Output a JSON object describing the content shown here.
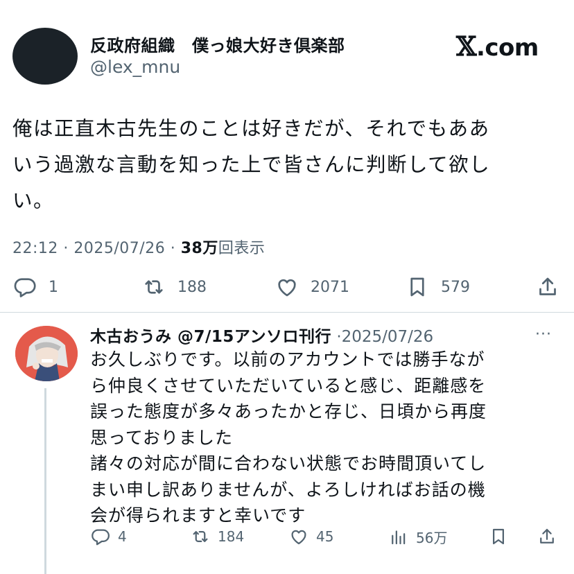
{
  "post": {
    "author_name": "反政府組織　僕っ娘大好き倶楽部",
    "author_handle": "@lex_mnu",
    "site_mark": "𝕏",
    "site_suffix": ".com",
    "text_lines": [
      "俺は正直木古先生のことは好きだが、それでもああ",
      "いう過激な言動を知った上で皆さんに判断して欲し",
      "い。"
    ],
    "time": "22:12",
    "separator": "·",
    "date": "2025/07/26",
    "views_count": "38万",
    "views_label": "回表示",
    "replies": "1",
    "reposts": "188",
    "likes": "2071",
    "bookmarks": "579"
  },
  "reply": {
    "author_name": "木古おうみ @7/15アンソロ刊行",
    "separator": "·",
    "date": "2025/07/26",
    "more": "···",
    "text_lines": [
      "お久しぶりです。以前のアカウントでは勝手なが",
      "ら仲良くさせていただいていると感じ、距離感を",
      "誤った態度が多々あったかと存じ、日頃から再度",
      "思っておりました",
      "諸々の対応が間に合わない状態でお時間頂いてし",
      "まい申し訳ありませんが、よろしければお話の機",
      "会が得られますと幸いです"
    ],
    "replies": "4",
    "reposts": "184",
    "likes": "45",
    "views": "56万"
  },
  "colors": {
    "text": "#0f1419",
    "secondary": "#536471",
    "divider": "#cfd9de",
    "avatar_dark": "#1b2228",
    "avatar_reply_bg": "#e45a4b"
  },
  "icons": [
    "reply-icon",
    "repost-icon",
    "like-icon",
    "bookmark-icon",
    "share-icon",
    "views-icon",
    "more-icon"
  ]
}
